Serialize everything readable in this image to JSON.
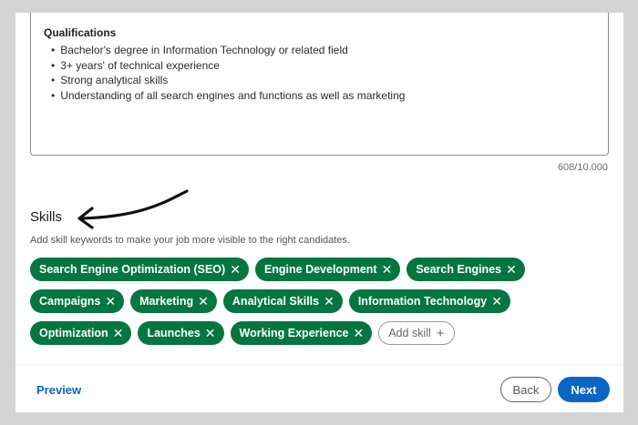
{
  "editor": {
    "heading": "Qualifications",
    "items": [
      "Bachelor's degree in Information Technology or related field",
      "3+ years' of technical experience",
      "Strong analytical skills",
      "Understanding of all search engines and functions as well as marketing"
    ],
    "char_count": "608/10.000"
  },
  "skills": {
    "title": "Skills",
    "help": "Add skill keywords to make your job more visible to the right candidates.",
    "remove_glyph": "✕",
    "rows": [
      [
        "Search Engine Optimization (SEO)",
        "Engine Development",
        "Search Engines"
      ],
      [
        "Campaigns",
        "Marketing",
        "Analytical Skills",
        "Information Technology"
      ],
      [
        "Optimization",
        "Launches",
        "Working Experience"
      ]
    ],
    "add_label": "Add skill",
    "add_glyph": "+"
  },
  "footer": {
    "preview": "Preview",
    "back": "Back",
    "next": "Next"
  },
  "colors": {
    "chip": "#057642",
    "primary": "#0a66c2",
    "background": "#d4d4d4"
  },
  "icons": {
    "annotation": "curved-arrow-icon",
    "remove": "close-icon",
    "add": "plus-icon"
  }
}
